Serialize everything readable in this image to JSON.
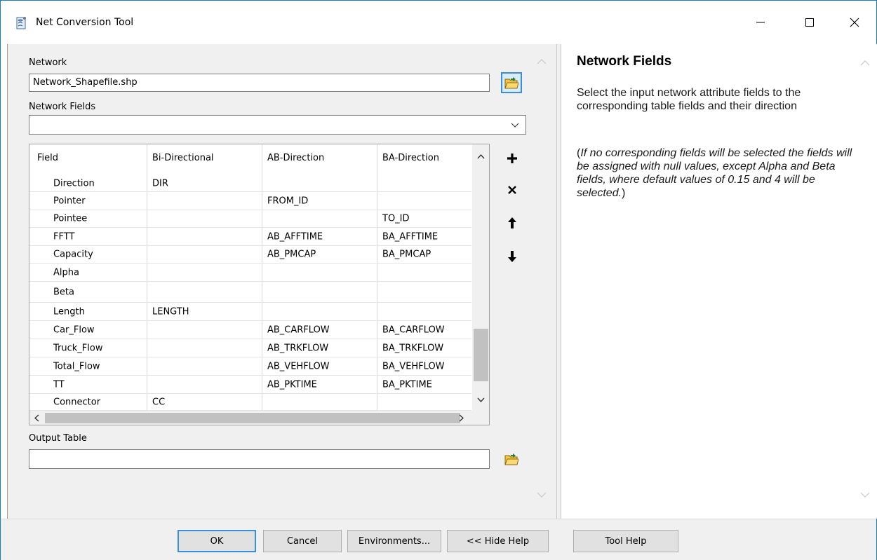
{
  "window": {
    "title": "Net Conversion Tool"
  },
  "form": {
    "network_label": "Network",
    "network_value": "Network_Shapefile.shp",
    "network_fields_label": "Network Fields",
    "network_fields_value": "",
    "output_table_label": "Output Table",
    "output_table_value": ""
  },
  "grid": {
    "columns": [
      "Field",
      "Bi-Directional",
      "AB-Direction",
      "BA-Direction"
    ],
    "rows": [
      {
        "field": "Direction",
        "bi": "DIR",
        "ab": "",
        "ba": ""
      },
      {
        "field": "Pointer",
        "bi": "",
        "ab": "FROM_ID",
        "ba": ""
      },
      {
        "field": "Pointee",
        "bi": "",
        "ab": "",
        "ba": "TO_ID"
      },
      {
        "field": "FFTT",
        "bi": "",
        "ab": "AB_AFFTIME",
        "ba": "BA_AFFTIME"
      },
      {
        "field": "Capacity",
        "bi": "",
        "ab": "AB_PMCAP",
        "ba": "BA_PMCAP"
      },
      {
        "field": "Alpha",
        "bi": "",
        "ab": "",
        "ba": ""
      },
      {
        "field": "Beta",
        "bi": "",
        "ab": "",
        "ba": ""
      },
      {
        "field": "Length",
        "bi": "LENGTH",
        "ab": "",
        "ba": ""
      },
      {
        "field": "Car_Flow",
        "bi": "",
        "ab": "AB_CARFLOW",
        "ba": "BA_CARFLOW"
      },
      {
        "field": "Truck_Flow",
        "bi": "",
        "ab": "AB_TRKFLOW",
        "ba": "BA_TRKFLOW"
      },
      {
        "field": "Total_Flow",
        "bi": "",
        "ab": "AB_VEHFLOW",
        "ba": "BA_VEHFLOW"
      },
      {
        "field": "TT",
        "bi": "",
        "ab": "AB_PKTIME",
        "ba": "BA_PKTIME"
      },
      {
        "field": "Connector",
        "bi": "CC",
        "ab": "",
        "ba": ""
      }
    ]
  },
  "side_buttons": {
    "add_icon": "plus-icon",
    "remove_icon": "x-icon",
    "up_icon": "arrow-up-icon",
    "down_icon": "arrow-down-icon"
  },
  "help": {
    "title": "Network Fields",
    "text": "Select the input network attribute fields to the corresponding table fields and their direction",
    "note_open": "(",
    "note_italic": "If no corresponding fields will be selected the fields will be assigned with null values, except Alpha and Beta fields, where default values of 0.15 and 4 will be selected.",
    "note_close": ")"
  },
  "buttons": {
    "ok": "OK",
    "cancel": "Cancel",
    "environments": "Environments...",
    "hide_help": "<< Hide Help",
    "tool_help": "Tool Help"
  },
  "colors": {
    "accent": "#3c8ed8",
    "panel_bg": "#f0f0f0",
    "folder_yellow": "#f5c542"
  }
}
